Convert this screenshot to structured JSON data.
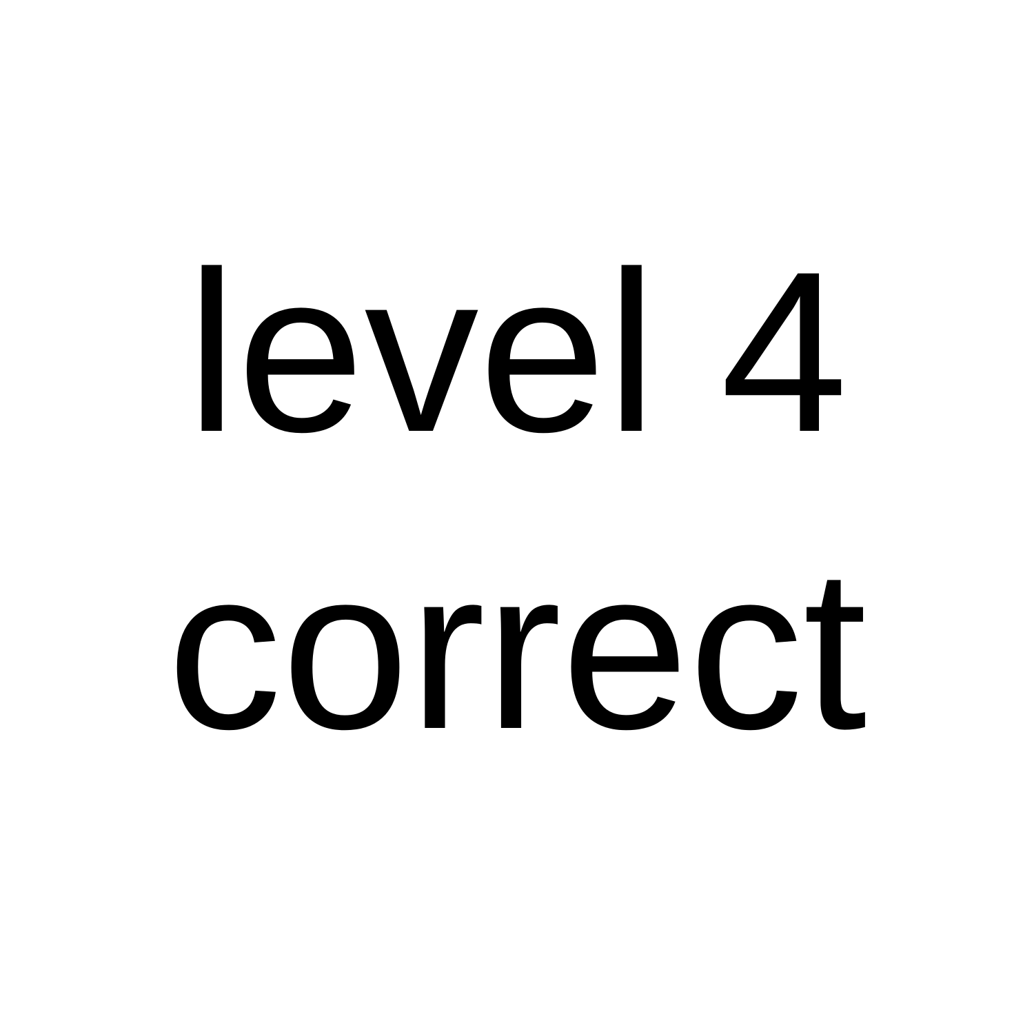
{
  "message": {
    "line1": "level 4",
    "line2": "correct"
  },
  "colors": {
    "background": "#ffffff",
    "text": "#000000"
  }
}
